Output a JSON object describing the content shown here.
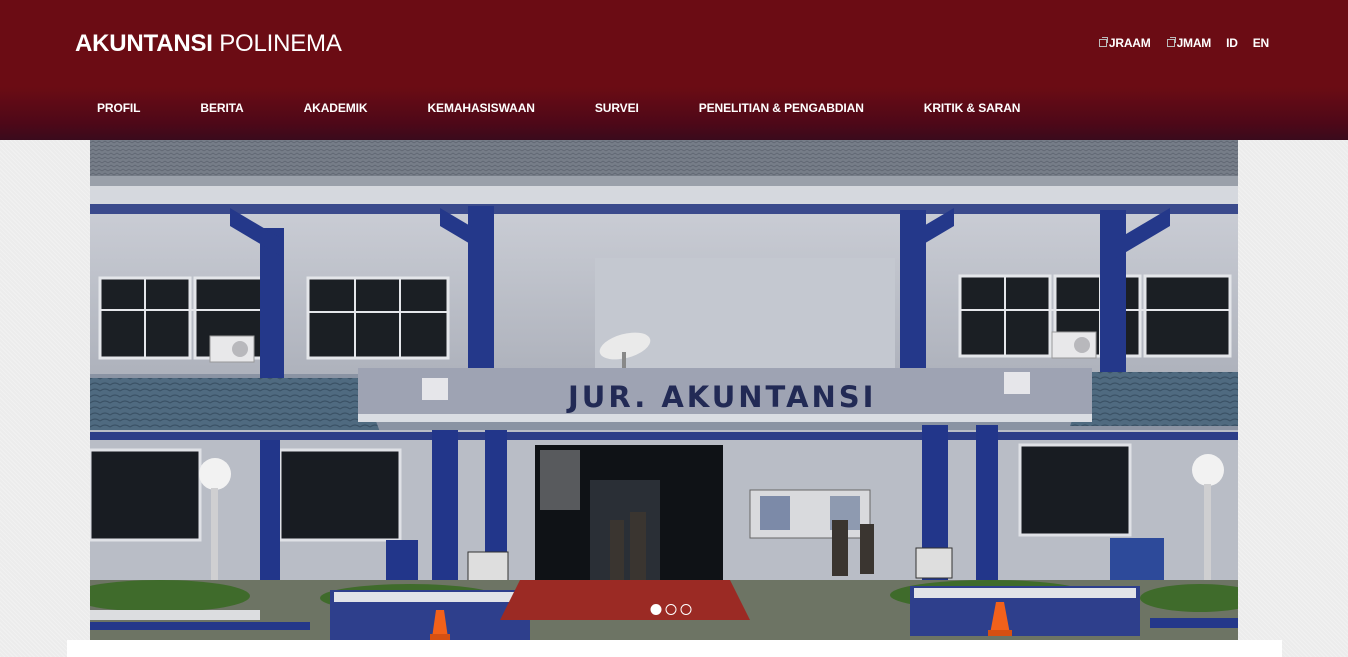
{
  "brand": {
    "bold": "AKUNTANSI",
    "light": "POLINEMA"
  },
  "top_links": [
    {
      "label": "JRAAM",
      "icon": "external-link-icon"
    },
    {
      "label": "JMAM",
      "icon": "external-link-icon"
    }
  ],
  "languages": [
    "ID",
    "EN"
  ],
  "nav": [
    {
      "label": "PROFIL"
    },
    {
      "label": "BERITA"
    },
    {
      "label": "AKADEMIK"
    },
    {
      "label": "KEMAHASISWAAN"
    },
    {
      "label": "SURVEI"
    },
    {
      "label": "PENELITIAN & PENGABDIAN"
    },
    {
      "label": "KRITIK & SARAN"
    }
  ],
  "slider": {
    "building_sign": "JUR. AKUNTANSI",
    "slides": 3,
    "active_slide": 1
  },
  "colors": {
    "header": "#6b0c14",
    "page_bg": "#ececec"
  }
}
